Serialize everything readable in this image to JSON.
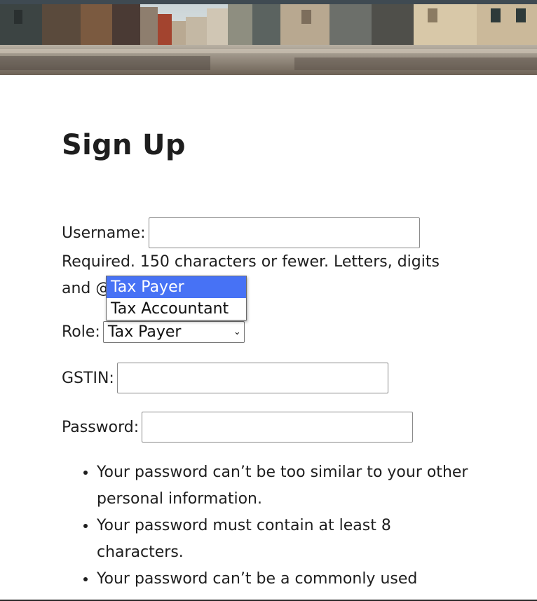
{
  "form": {
    "title": "Sign Up",
    "username_label": "Username:",
    "username_value": "",
    "username_help": "Required. 150 characters or fewer. Letters, digits and @",
    "role_label": "Role:",
    "role_selected": "Tax Payer",
    "role_options": [
      "Tax Payer",
      "Tax Accountant"
    ],
    "gstin_label": "GSTIN:",
    "gstin_value": "",
    "password_label": "Password:",
    "password_value": "",
    "password_rules": [
      "Your password can’t be too similar to your other personal information.",
      "Your password must contain at least 8 characters.",
      "Your password can’t be a commonly used"
    ]
  },
  "colors": {
    "dropdown_highlight": "#4772f5",
    "text": "#1e1e1e",
    "background": "#ffffff"
  }
}
